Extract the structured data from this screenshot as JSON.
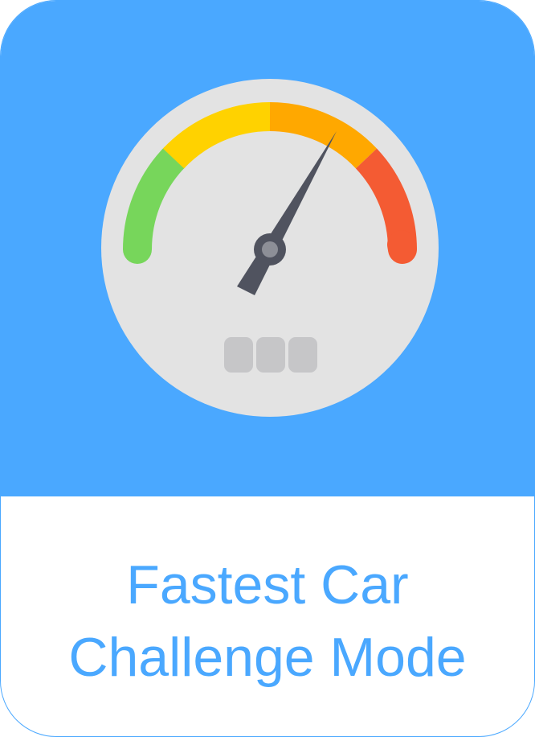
{
  "card": {
    "title_line_1": "Fastest Car",
    "title_line_2": "Challenge Mode"
  },
  "icon": {
    "name": "speedometer-icon",
    "needle_level": 0.78
  },
  "colors": {
    "accent": "#4aa8ff",
    "dial_face": "#e3e3e3",
    "zone_green": "#77d65b",
    "zone_yellow": "#ffd200",
    "zone_orange": "#ffa800",
    "zone_red": "#f45b33",
    "needle": "#50535f",
    "odometer_block": "#c6c6c8",
    "background": "#ffffff"
  }
}
